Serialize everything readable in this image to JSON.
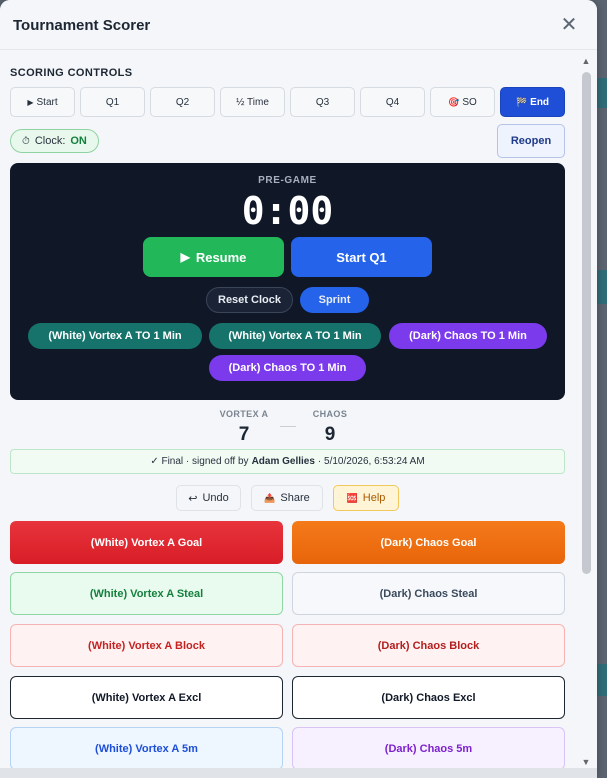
{
  "modal": {
    "title": "Tournament Scorer",
    "close_icon": "✕"
  },
  "scoring": {
    "section_label": "SCORING CONTROLS",
    "buttons": [
      {
        "icon": "▶",
        "label": "Start"
      },
      {
        "icon": "",
        "label": "Q1"
      },
      {
        "icon": "",
        "label": "Q2"
      },
      {
        "icon": "",
        "label": "½ Time"
      },
      {
        "icon": "",
        "label": "Q3"
      },
      {
        "icon": "",
        "label": "Q4"
      },
      {
        "icon": "🎯",
        "label": "SO"
      },
      {
        "icon": "🏁",
        "label": "End"
      }
    ],
    "clock_label": "Clock:",
    "clock_state": "ON",
    "reopen_label": "Reopen"
  },
  "panel": {
    "phase": "PRE-GAME",
    "clock": "0:00",
    "resume_label": "Resume",
    "resume_icon": "▶",
    "start_label": "Start Q1",
    "reset_label": "Reset Clock",
    "sprint_label": "Sprint",
    "timeouts": [
      "(White) Vortex A TO 1 Min",
      "(White) Vortex A TO 1 Min",
      "(Dark) Chaos TO 1 Min",
      "(Dark) Chaos TO 1 Min"
    ]
  },
  "score": {
    "home_name": "VORTEX A",
    "home_score": "7",
    "away_name": "CHAOS",
    "away_score": "9"
  },
  "final": {
    "prefix": "✓ Final · signed off by",
    "signer": "Adam Gellies",
    "timestamp": "· 5/10/2026, 6:53:24 AM"
  },
  "actions": {
    "undo_icon": "↩",
    "undo_label": "Undo",
    "share_icon": "📤",
    "share_label": "Share",
    "help_icon": "🆘",
    "help_label": "Help"
  },
  "score_buttons": [
    {
      "left": "(White) Vortex A Goal",
      "right": "(Dark) Chaos Goal"
    },
    {
      "left": "(White) Vortex A Steal",
      "right": "(Dark) Chaos Steal"
    },
    {
      "left": "(White) Vortex A Block",
      "right": "(Dark) Chaos Block"
    },
    {
      "left": "(White) Vortex A Excl",
      "right": "(Dark) Chaos Excl"
    },
    {
      "left": "(White) Vortex A 5m",
      "right": "(Dark) Chaos 5m"
    }
  ],
  "colors": {
    "accent_blue": "#1f4fd6",
    "goal_white": "#e0242c",
    "goal_dark": "#ef6a0c",
    "resume_green": "#22b85a",
    "panel_bg": "#101828"
  }
}
